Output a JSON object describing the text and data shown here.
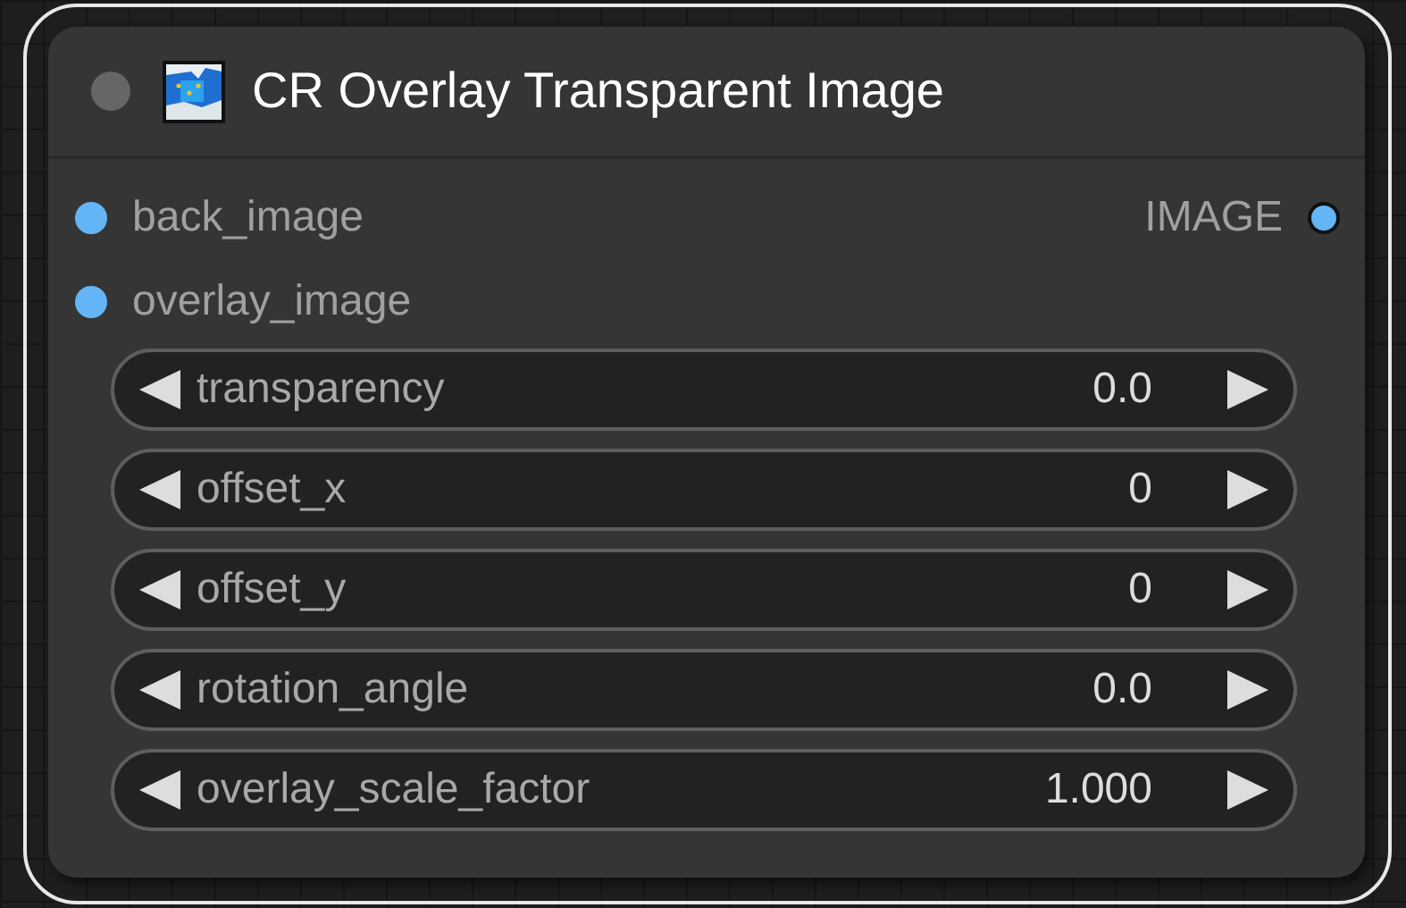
{
  "node": {
    "title": "CR Overlay Transparent Image",
    "selected": true,
    "inputs": [
      {
        "name": "back_image"
      },
      {
        "name": "overlay_image"
      }
    ],
    "outputs": [
      {
        "name": "IMAGE"
      }
    ],
    "widgets": [
      {
        "label": "transparency",
        "value": "0.0"
      },
      {
        "label": "offset_x",
        "value": "0"
      },
      {
        "label": "offset_y",
        "value": "0"
      },
      {
        "label": "rotation_angle",
        "value": "0.0"
      },
      {
        "label": "overlay_scale_factor",
        "value": "1.000"
      }
    ]
  }
}
